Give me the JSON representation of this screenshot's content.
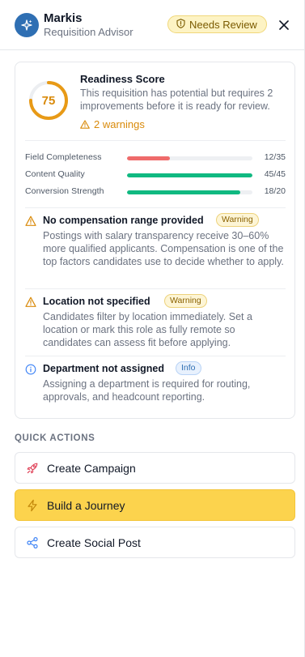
{
  "header": {
    "app_name": "Markis",
    "subtitle": "Requisition Advisor",
    "status_badge": "Needs Review"
  },
  "readiness": {
    "score": "75",
    "score_fraction": 0.75,
    "title": "Readiness Score",
    "description": "This requisition has potential but requires 2 improvements before it is ready for review.",
    "warnings_label": "2 warnings",
    "accent_color": "#d98a0a"
  },
  "metrics": [
    {
      "label": "Field Completeness",
      "value": "12/35",
      "fraction": 0.343,
      "color": "#ef6b6b"
    },
    {
      "label": "Content Quality",
      "value": "45/45",
      "fraction": 1.0,
      "color": "#10b981"
    },
    {
      "label": "Conversion Strength",
      "value": "18/20",
      "fraction": 0.9,
      "color": "#10b981"
    }
  ],
  "issues": [
    {
      "title": "No compensation range provided",
      "badge": "Warning",
      "severity": "warning",
      "description": "Postings with salary transparency receive 30–60% more qualified applicants. Compensation is one of the top factors candidates use to decide whether to apply."
    },
    {
      "title": "Location not specified",
      "badge": "Warning",
      "severity": "warning",
      "description": "Candidates filter by location immediately. Set a location or mark this role as fully remote so candidates can assess fit before applying."
    },
    {
      "title": "Department not assigned",
      "badge": "Info",
      "severity": "info",
      "description": "Assigning a department is required for routing, approvals, and headcount reporting."
    }
  ],
  "quick_actions": {
    "title": "QUICK ACTIONS",
    "items": [
      {
        "label": "Create Campaign",
        "icon": "rocket-icon"
      },
      {
        "label": "Build a Journey",
        "icon": "lightning-icon"
      },
      {
        "label": "Create Social Post",
        "icon": "share-icon"
      }
    ]
  }
}
